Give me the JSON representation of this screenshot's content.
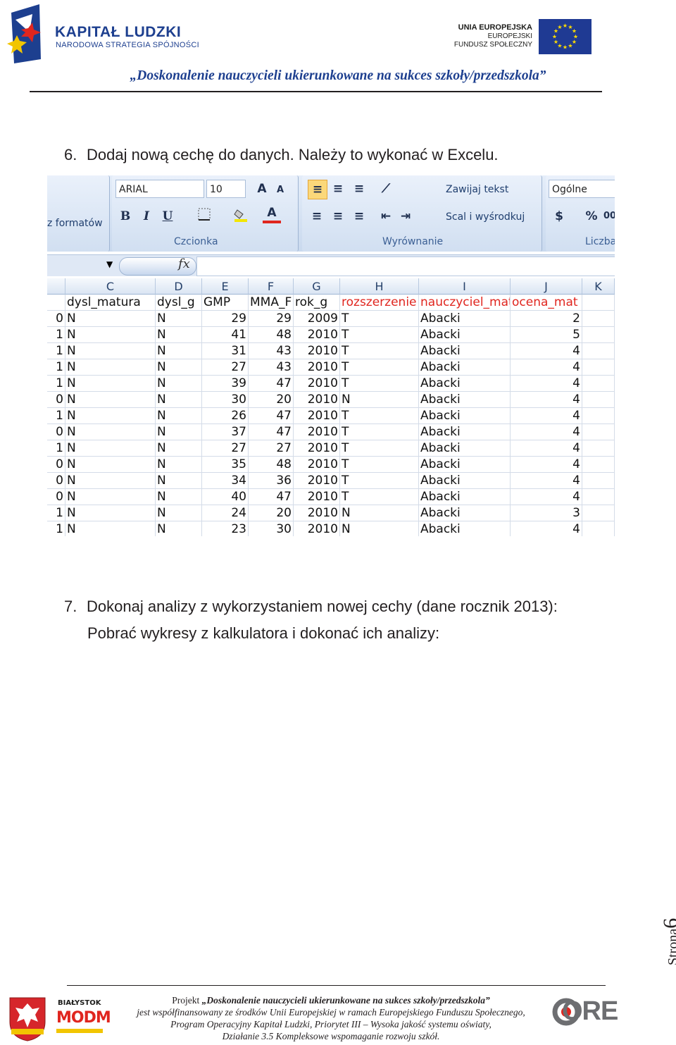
{
  "header": {
    "brand_title": "KAPITAŁ LUDZKI",
    "brand_subtitle": "NARODOWA STRATEGIA SPÓJNOŚCI",
    "eu_line1": "UNIA EUROPEJSKA",
    "eu_line2": "EUROPEJSKI",
    "eu_line3": "FUNDUSZ SPOŁECZNY",
    "slogan": "„Doskonalenie nauczycieli ukierunkowane na sukces szkoły/przedszkola”"
  },
  "colors": {
    "brand_blue": "#1d3f8f",
    "eu_blue": "#1f3a93",
    "eu_gold": "#ffdd00",
    "red_header": "#e0261f"
  },
  "item6": {
    "number": "6.",
    "text": "Dodaj nową cechę do danych. Należy to wykonać w Excelu."
  },
  "excel": {
    "ribbon": {
      "left_fragment": "z formatów",
      "font_name": "ARIAL",
      "font_size": "10",
      "grow_font": "A",
      "shrink_font": "A",
      "bold": "B",
      "italic": "I",
      "underline": "U",
      "font_color": "A",
      "group_font": "Czcionka",
      "wrap_text": "Zawijaj tekst",
      "merge_center": "Scal i wyśrodkuj",
      "group_alignment": "Wyrównanie",
      "number_format": "Ogólne",
      "percent": "%",
      "comma": "00",
      "group_number": "Liczba",
      "fx": "fx"
    },
    "columns": [
      "C",
      "D",
      "E",
      "F",
      "G",
      "H",
      "I",
      "J",
      "K"
    ],
    "headers": [
      "dysl_matura",
      "dysl_g",
      "GMP",
      "MMA_F",
      "rok_g",
      "rozszerzenie",
      "nauczyciel_mat",
      "ocena_mat"
    ],
    "rows": [
      [
        "0",
        "N",
        "N",
        "29",
        "29",
        "2009",
        "T",
        "Abacki",
        "2"
      ],
      [
        "1",
        "N",
        "N",
        "41",
        "48",
        "2010",
        "T",
        "Abacki",
        "5"
      ],
      [
        "1",
        "N",
        "N",
        "31",
        "43",
        "2010",
        "T",
        "Abacki",
        "4"
      ],
      [
        "1",
        "N",
        "N",
        "27",
        "43",
        "2010",
        "T",
        "Abacki",
        "4"
      ],
      [
        "1",
        "N",
        "N",
        "39",
        "47",
        "2010",
        "T",
        "Abacki",
        "4"
      ],
      [
        "0",
        "N",
        "N",
        "30",
        "20",
        "2010",
        "N",
        "Abacki",
        "4"
      ],
      [
        "1",
        "N",
        "N",
        "26",
        "47",
        "2010",
        "T",
        "Abacki",
        "4"
      ],
      [
        "0",
        "N",
        "N",
        "37",
        "47",
        "2010",
        "T",
        "Abacki",
        "4"
      ],
      [
        "1",
        "N",
        "N",
        "27",
        "27",
        "2010",
        "T",
        "Abacki",
        "4"
      ],
      [
        "0",
        "N",
        "N",
        "35",
        "48",
        "2010",
        "T",
        "Abacki",
        "4"
      ],
      [
        "0",
        "N",
        "N",
        "34",
        "36",
        "2010",
        "T",
        "Abacki",
        "4"
      ],
      [
        "0",
        "N",
        "N",
        "40",
        "47",
        "2010",
        "T",
        "Abacki",
        "4"
      ],
      [
        "1",
        "N",
        "N",
        "24",
        "20",
        "2010",
        "N",
        "Abacki",
        "3"
      ],
      [
        "1",
        "N",
        "N",
        "23",
        "30",
        "2010",
        "N",
        "Abacki",
        "4"
      ]
    ]
  },
  "item7": {
    "number": "7.",
    "text": "Dokonaj analizy z wykorzystaniem nowej cechy (dane rocznik 2013):",
    "subtext": "Pobrać wykresy z  kalkulatora i dokonać ich analizy:"
  },
  "page_label": {
    "word": "Strona",
    "number": "6"
  },
  "footer": {
    "line1_prefix": "Projekt ",
    "line1_title": "„Doskonalenie nauczycieli ukierunkowane na sukces szkoły/przedszkola”",
    "line2": "jest współfinansowany ze środków Unii Europejskiej w ramach Europejskiego Funduszu Społecznego,",
    "line3": "Program Operacyjny Kapitał Ludzki, Priorytet III – Wysoka jakość systemu oświaty,",
    "line4": "Działanie 3.5 Kompleksowe wspomaganie rozwoju szkół.",
    "logo_bialystok_label": "BIAŁYSTOK",
    "logo_modm": "MODM",
    "logo_ore": "ORE"
  }
}
